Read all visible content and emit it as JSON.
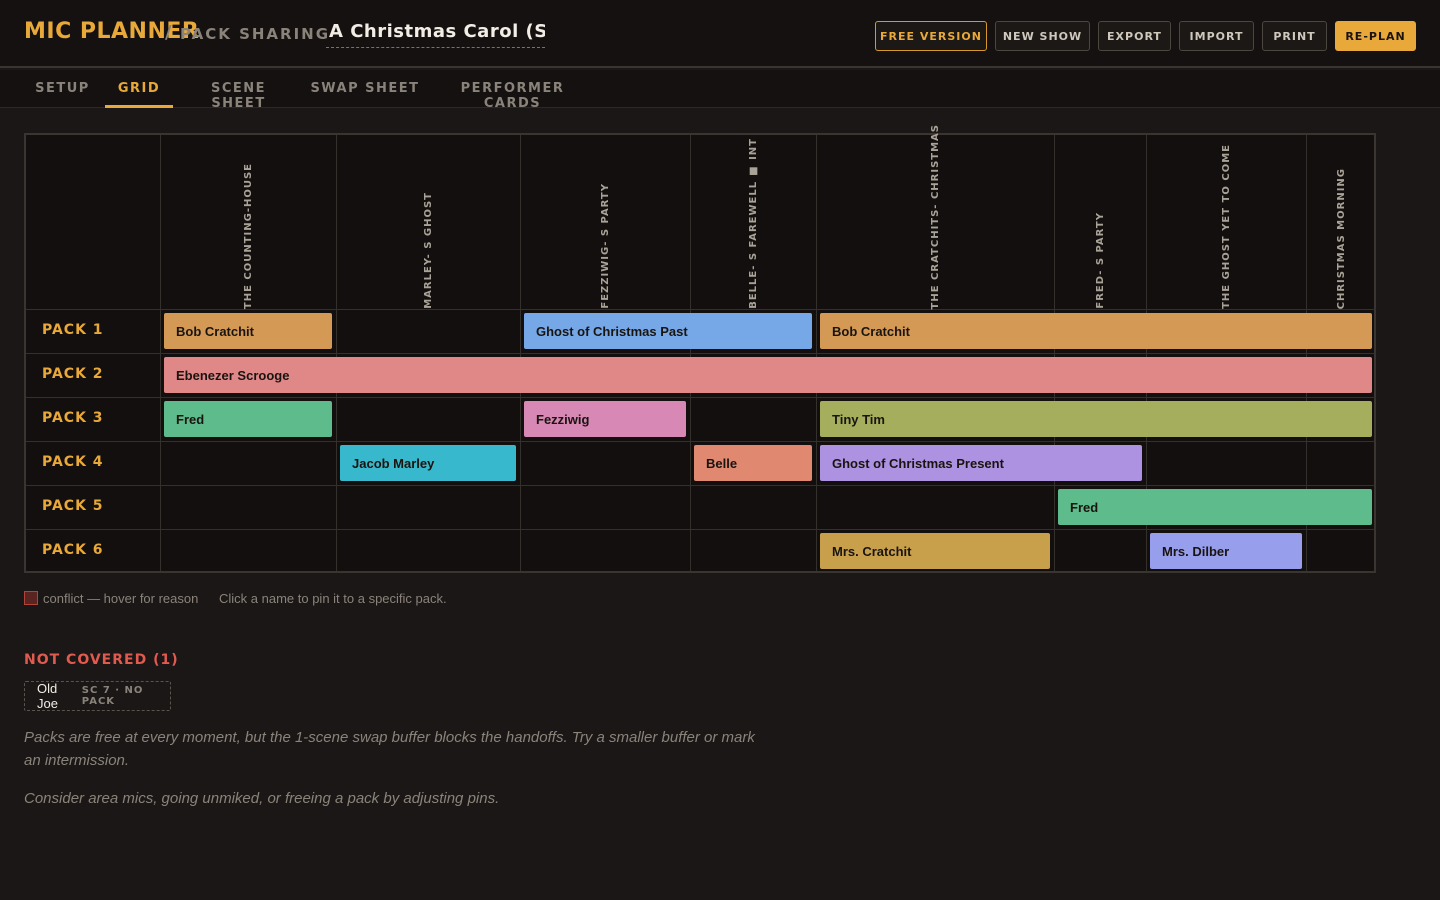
{
  "app": {
    "brand": "MIC PLANNER",
    "separator": "/",
    "subtitle": "PACK SHARING",
    "show_title": "A Christmas Carol (Sample)"
  },
  "toolbar": {
    "free_version": "FREE VERSION",
    "new_show": "NEW SHOW",
    "export": "EXPORT",
    "import": "IMPORT",
    "print": "PRINT",
    "replan": "RE-PLAN"
  },
  "tabs": [
    {
      "label": "SETUP",
      "active": false
    },
    {
      "label": "GRID",
      "active": true
    },
    {
      "label": "SCENE SHEET",
      "active": false
    },
    {
      "label": "SWAP SHEET",
      "active": false
    },
    {
      "label": "PERFORMER CARDS",
      "active": false
    }
  ],
  "grid": {
    "scenes": [
      "THE COUNTING-HOUSE",
      "MARLEY-  S GHOST",
      "FEZZIWIG-  S PARTY",
      "BELLE-  S FAREWELL ■ INT",
      "THE CRATCHITS-  CHRISTMAS",
      "FRED-  S PARTY",
      "THE GHOST YET TO COME",
      "CHRISTMAS MORNING"
    ],
    "packs": [
      "PACK 1",
      "PACK 2",
      "PACK 3",
      "PACK 4",
      "PACK 5",
      "PACK 6"
    ],
    "assignments": [
      {
        "pack": 0,
        "start": 0,
        "end": 0,
        "name": "Bob Cratchit",
        "color": "#d49a55"
      },
      {
        "pack": 0,
        "start": 2,
        "end": 3,
        "name": "Ghost of Christmas Past",
        "color": "#76a8e8"
      },
      {
        "pack": 0,
        "start": 4,
        "end": 7,
        "name": "Bob Cratchit",
        "color": "#d49a55"
      },
      {
        "pack": 1,
        "start": 0,
        "end": 7,
        "name": "Ebenezer Scrooge",
        "color": "#e08888"
      },
      {
        "pack": 2,
        "start": 0,
        "end": 0,
        "name": "Fred",
        "color": "#5dbb8c"
      },
      {
        "pack": 2,
        "start": 2,
        "end": 2,
        "name": "Fezziwig",
        "color": "#d888b4"
      },
      {
        "pack": 2,
        "start": 4,
        "end": 7,
        "name": "Tiny Tim",
        "color": "#a4ae5c"
      },
      {
        "pack": 3,
        "start": 1,
        "end": 1,
        "name": "Jacob Marley",
        "color": "#38b8cc"
      },
      {
        "pack": 3,
        "start": 3,
        "end": 3,
        "name": "Belle",
        "color": "#e08870"
      },
      {
        "pack": 3,
        "start": 4,
        "end": 5,
        "name": "Ghost of Christmas Present",
        "color": "#ac92e0"
      },
      {
        "pack": 4,
        "start": 5,
        "end": 7,
        "name": "Fred",
        "color": "#5dbb8c"
      },
      {
        "pack": 5,
        "start": 4,
        "end": 4,
        "name": "Mrs. Cratchit",
        "color": "#c8a04c"
      },
      {
        "pack": 5,
        "start": 6,
        "end": 6,
        "name": "Mrs. Dilber",
        "color": "#979eec"
      }
    ]
  },
  "legend": {
    "conflict": "conflict — hover for reason",
    "hint": "Click a name to pin it to a specific pack."
  },
  "not_covered": {
    "title": "NOT COVERED (1)",
    "items": [
      {
        "name": "Old Joe",
        "meta": "SC 7 · NO PACK"
      }
    ]
  },
  "notes": [
    "Packs are free at every moment, but the 1-scene swap buffer blocks the handoffs. Try a smaller buffer or mark an intermission.",
    "Consider area mics, going unmiked, or freeing a pack by adjusting pins."
  ]
}
